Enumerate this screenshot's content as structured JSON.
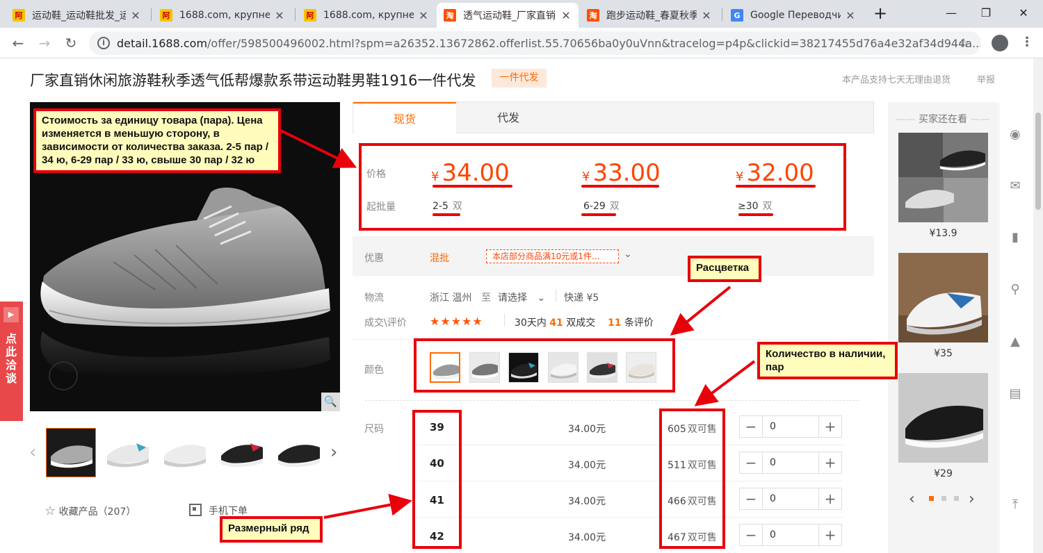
{
  "browser": {
    "tabs": [
      {
        "title": "运动鞋_运动鞋批发_运动",
        "icon": "alibaba-icon",
        "active": false
      },
      {
        "title": "1688.com, крупнейшая",
        "icon": "alibaba-icon",
        "active": false
      },
      {
        "title": "1688.com, крупнейшая",
        "icon": "alibaba-icon",
        "active": false
      },
      {
        "title": "透气运动鞋_厂家直销",
        "icon": "taobao-icon",
        "active": true
      },
      {
        "title": "跑步运动鞋_春夏秋季",
        "icon": "taobao-icon",
        "active": false
      },
      {
        "title": "Google Переводчик",
        "icon": "google-translate-icon",
        "active": false
      }
    ],
    "url_host": "detail.1688.com",
    "url_path": "/offer/598500496002.html?spm=a26352.13672862.offerlist.55.70656ba0y0uVnn&tracelog=p4p&clickid=38217455d76a4e32af34d944a..."
  },
  "product": {
    "title": "厂家直销休闲旅游鞋秋季透气低帮爆款系带运动鞋男鞋1916一件代发",
    "badge": "一件代发",
    "return_policy": "本产品支持七天无理由退货",
    "report": "举报",
    "favorite": "收藏产品（207）",
    "mobile_order": "手机下单",
    "chat": "点此洽谈"
  },
  "tabs": {
    "spot": "现货",
    "dropship": "代发"
  },
  "pricing": {
    "price_label": "价格",
    "moq_label": "起批量",
    "currency": "¥",
    "unit": "双",
    "tiers": [
      {
        "price": "34.00",
        "range": "2-5"
      },
      {
        "price": "33.00",
        "range": "6-29"
      },
      {
        "price": "32.00",
        "range": "≥30"
      }
    ]
  },
  "promo": {
    "label": "优惠",
    "type": "混批",
    "coupon": "本店部分商品满10元或1件..."
  },
  "logistics": {
    "label": "物流",
    "from": "浙江 温州",
    "to_word": "至",
    "select": "请选择",
    "express": "快递 ¥5"
  },
  "deals": {
    "label": "成交\\评价",
    "stars": "★★★★★",
    "pre": "30天内",
    "count": "41",
    "post": "双成交",
    "reviews": "11",
    "reviews_post": "条评价"
  },
  "colors": {
    "label": "颜色"
  },
  "sizes": {
    "label": "尺码",
    "rows": [
      {
        "size": "39",
        "price": "34.00元",
        "stock": "605",
        "stock_unit": "双可售",
        "qty": "0"
      },
      {
        "size": "40",
        "price": "34.00元",
        "stock": "511",
        "stock_unit": "双可售",
        "qty": "0"
      },
      {
        "size": "41",
        "price": "34.00元",
        "stock": "466",
        "stock_unit": "双可售",
        "qty": "0"
      },
      {
        "size": "42",
        "price": "34.00元",
        "stock": "467",
        "stock_unit": "双可售",
        "qty": "0"
      }
    ]
  },
  "recommend": {
    "title": "买家还在看",
    "items": [
      {
        "price": "¥13.9"
      },
      {
        "price": "¥35"
      },
      {
        "price": "¥29"
      }
    ]
  },
  "annotations": {
    "price_note": "Стоимость за единицу товара (пара). Цена изменяется в меньшую сторону, в зависимости от количества заказа. 2-5 пар / 34 ю, 6-29 пар / 33 ю, свыше 30 пар / 32 ю",
    "color_note": "Расцветка",
    "stock_note": "Количество в наличии, пар",
    "size_note": "Размерный ряд"
  },
  "colors_theme": {
    "accent": "#ff6a00",
    "price": "#ff4400",
    "annotation_red": "#e8000b",
    "annotation_bg": "#fffcbc"
  }
}
